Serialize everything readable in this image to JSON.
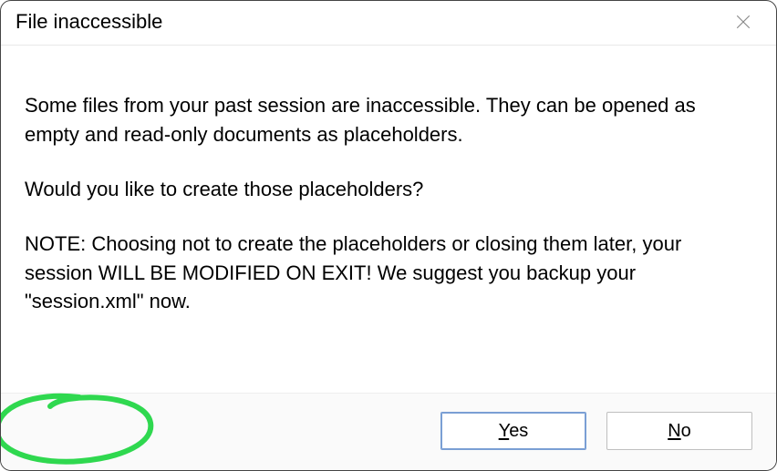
{
  "dialog": {
    "title": "File inaccessible",
    "paragraph1": "Some files from your past session are inaccessible. They can be opened as empty and read-only documents as placeholders.",
    "paragraph2": "Would you like to create those placeholders?",
    "paragraph3": "NOTE: Choosing not to create the placeholders or closing them later, your session WILL BE MODIFIED ON EXIT! We suggest you backup your \"session.xml\" now.",
    "yes_prefix": "Y",
    "yes_rest": "es",
    "no_prefix": "N",
    "no_rest": "o"
  },
  "annotation": {
    "color": "#2fd84f"
  }
}
